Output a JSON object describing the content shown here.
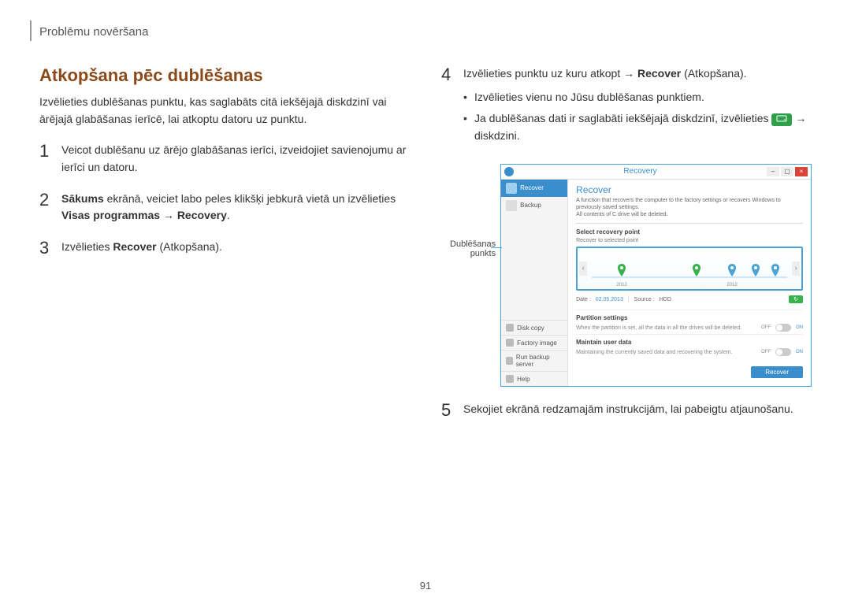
{
  "breadcrumb": "Problēmu novēršana",
  "section_title": "Atkopšana pēc dublēšanas",
  "intro": "Izvēlieties dublēšanas punktu, kas saglabāts citā iekšējajā diskdzinī vai ārējajā glabāšanas ierīcē, lai atkoptu datoru uz punktu.",
  "steps": {
    "s1": "Veicot dublēšanu uz ārējo glabāšanas ierīci, izveidojiet savienojumu ar ierīci un datoru.",
    "s2_pre": "Sākums",
    "s2_mid": " ekrānā, veiciet labo peles klikšķi jebkurā vietā un izvēlieties ",
    "s2_b1": "Visas programmas",
    "s2_arrow": " → ",
    "s2_b2": "Recovery",
    "s2_end": ".",
    "s3_pre": "Izvēlieties ",
    "s3_b": "Recover",
    "s3_post": " (Atkopšana).",
    "s4_pre": "Izvēlieties punktu uz kuru atkopt → ",
    "s4_b": "Recover",
    "s4_post": " (Atkopšana).",
    "s4_bul1": "Izvēlieties vienu no Jūsu dublēšanas punktiem.",
    "s4_bul2_a": "Ja dublēšanas dati ir saglabāti iekšējajā diskdzinī, izvēlieties ",
    "s4_bul2_b": " → diskdzini.",
    "s5": "Sekojiet ekrānā redzamajām instrukcijām, lai pabeigtu atjaunošanu."
  },
  "callout": "Dublēšanas punkts",
  "shot": {
    "window_title": "Recovery",
    "side": {
      "recover": "Recover",
      "backup": "Backup",
      "disk_copy": "Disk copy",
      "factory_image": "Factory image",
      "run_backup_server": "Run backup server",
      "help": "Help"
    },
    "main": {
      "heading": "Recover",
      "desc1": "A function that recovers the computer to the factory settings or recovers Windows to previously saved settings.",
      "desc2": "All contents of C drive will be deleted.",
      "select_point_label": "Select recovery point",
      "select_point_sub": "Recover to selected point",
      "years": {
        "a": "2012",
        "b": "2012"
      },
      "info_date_label": "Date :",
      "info_date": "02.05.2013",
      "info_source_label": "Source :",
      "info_source": "HDD",
      "refresh": "↻",
      "partition_label": "Partition settings",
      "partition_desc": "When the partition is set, all the data in all the drives will be deleted.",
      "maintain_label": "Maintain user data",
      "maintain_desc": "Maintaining the currently saved data and recovering the system.",
      "toggle_off": "OFF",
      "toggle_on": "ON",
      "recover_btn": "Recover"
    }
  },
  "page_number": "91"
}
